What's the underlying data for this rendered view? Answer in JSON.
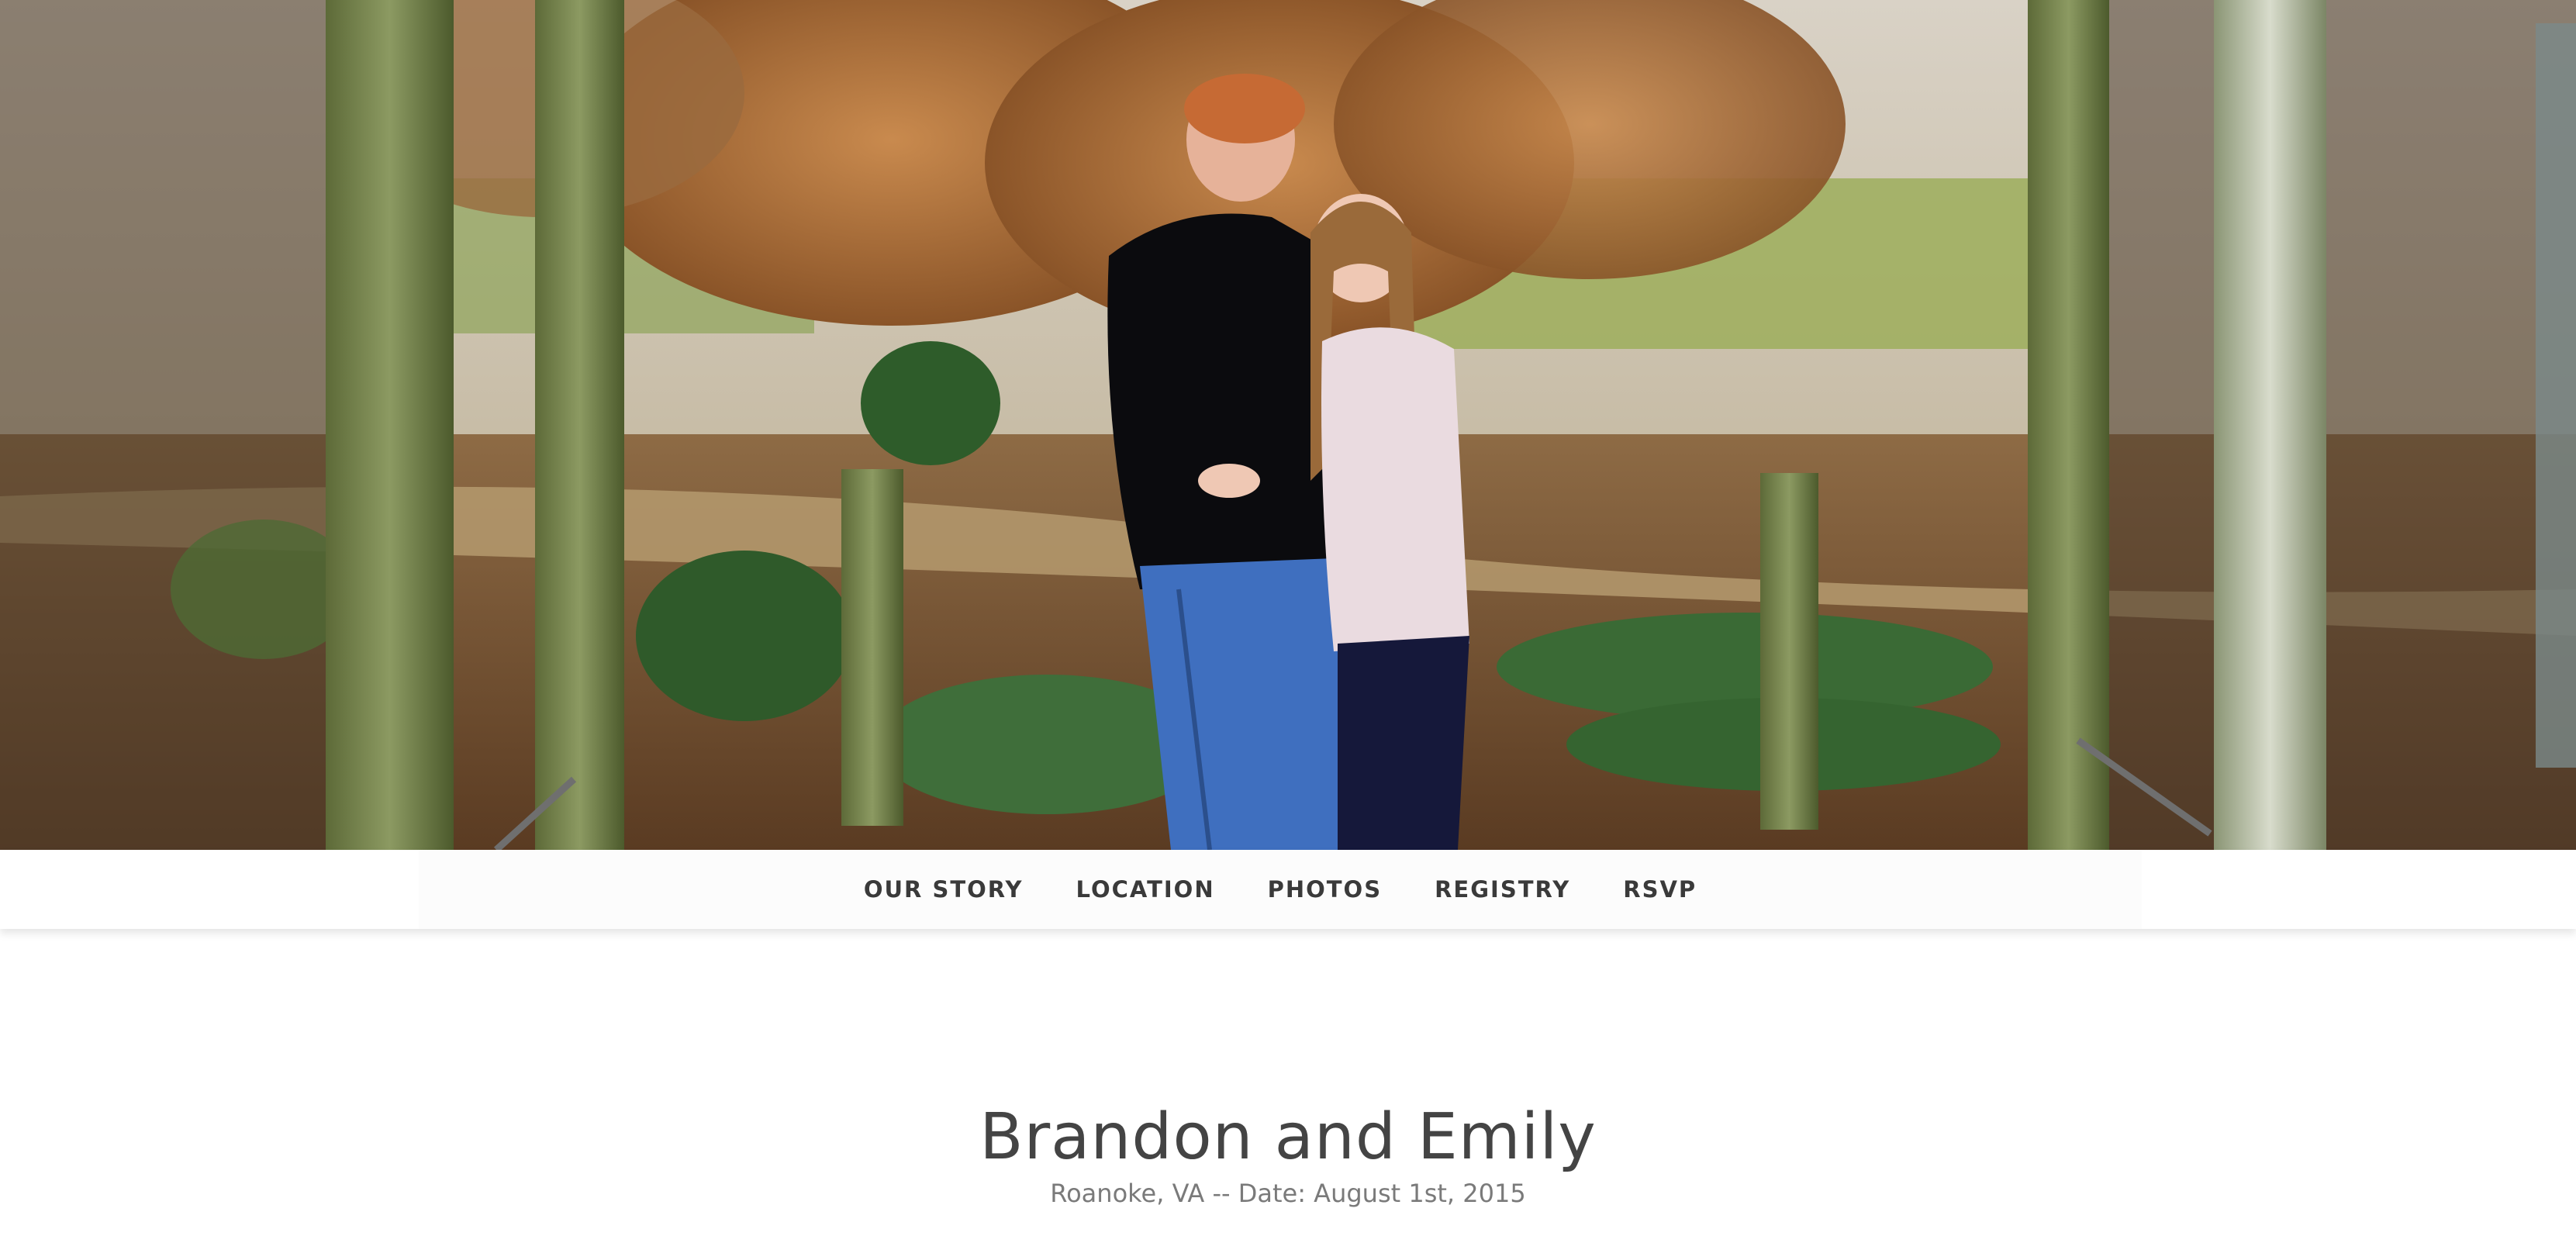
{
  "hero": {
    "photo_subject": "couple-photo"
  },
  "nav": {
    "items": [
      {
        "label": "OUR STORY"
      },
      {
        "label": "LOCATION"
      },
      {
        "label": "PHOTOS"
      },
      {
        "label": "REGISTRY"
      },
      {
        "label": "RSVP"
      }
    ]
  },
  "intro": {
    "title": "Brandon and Emily",
    "subtitle": "Roanoke, VA -- Date: August 1st, 2015"
  },
  "colors": {
    "nav_text": "#3a3a3a",
    "title_text": "#444444",
    "subtitle_text": "#7a7a7a"
  }
}
